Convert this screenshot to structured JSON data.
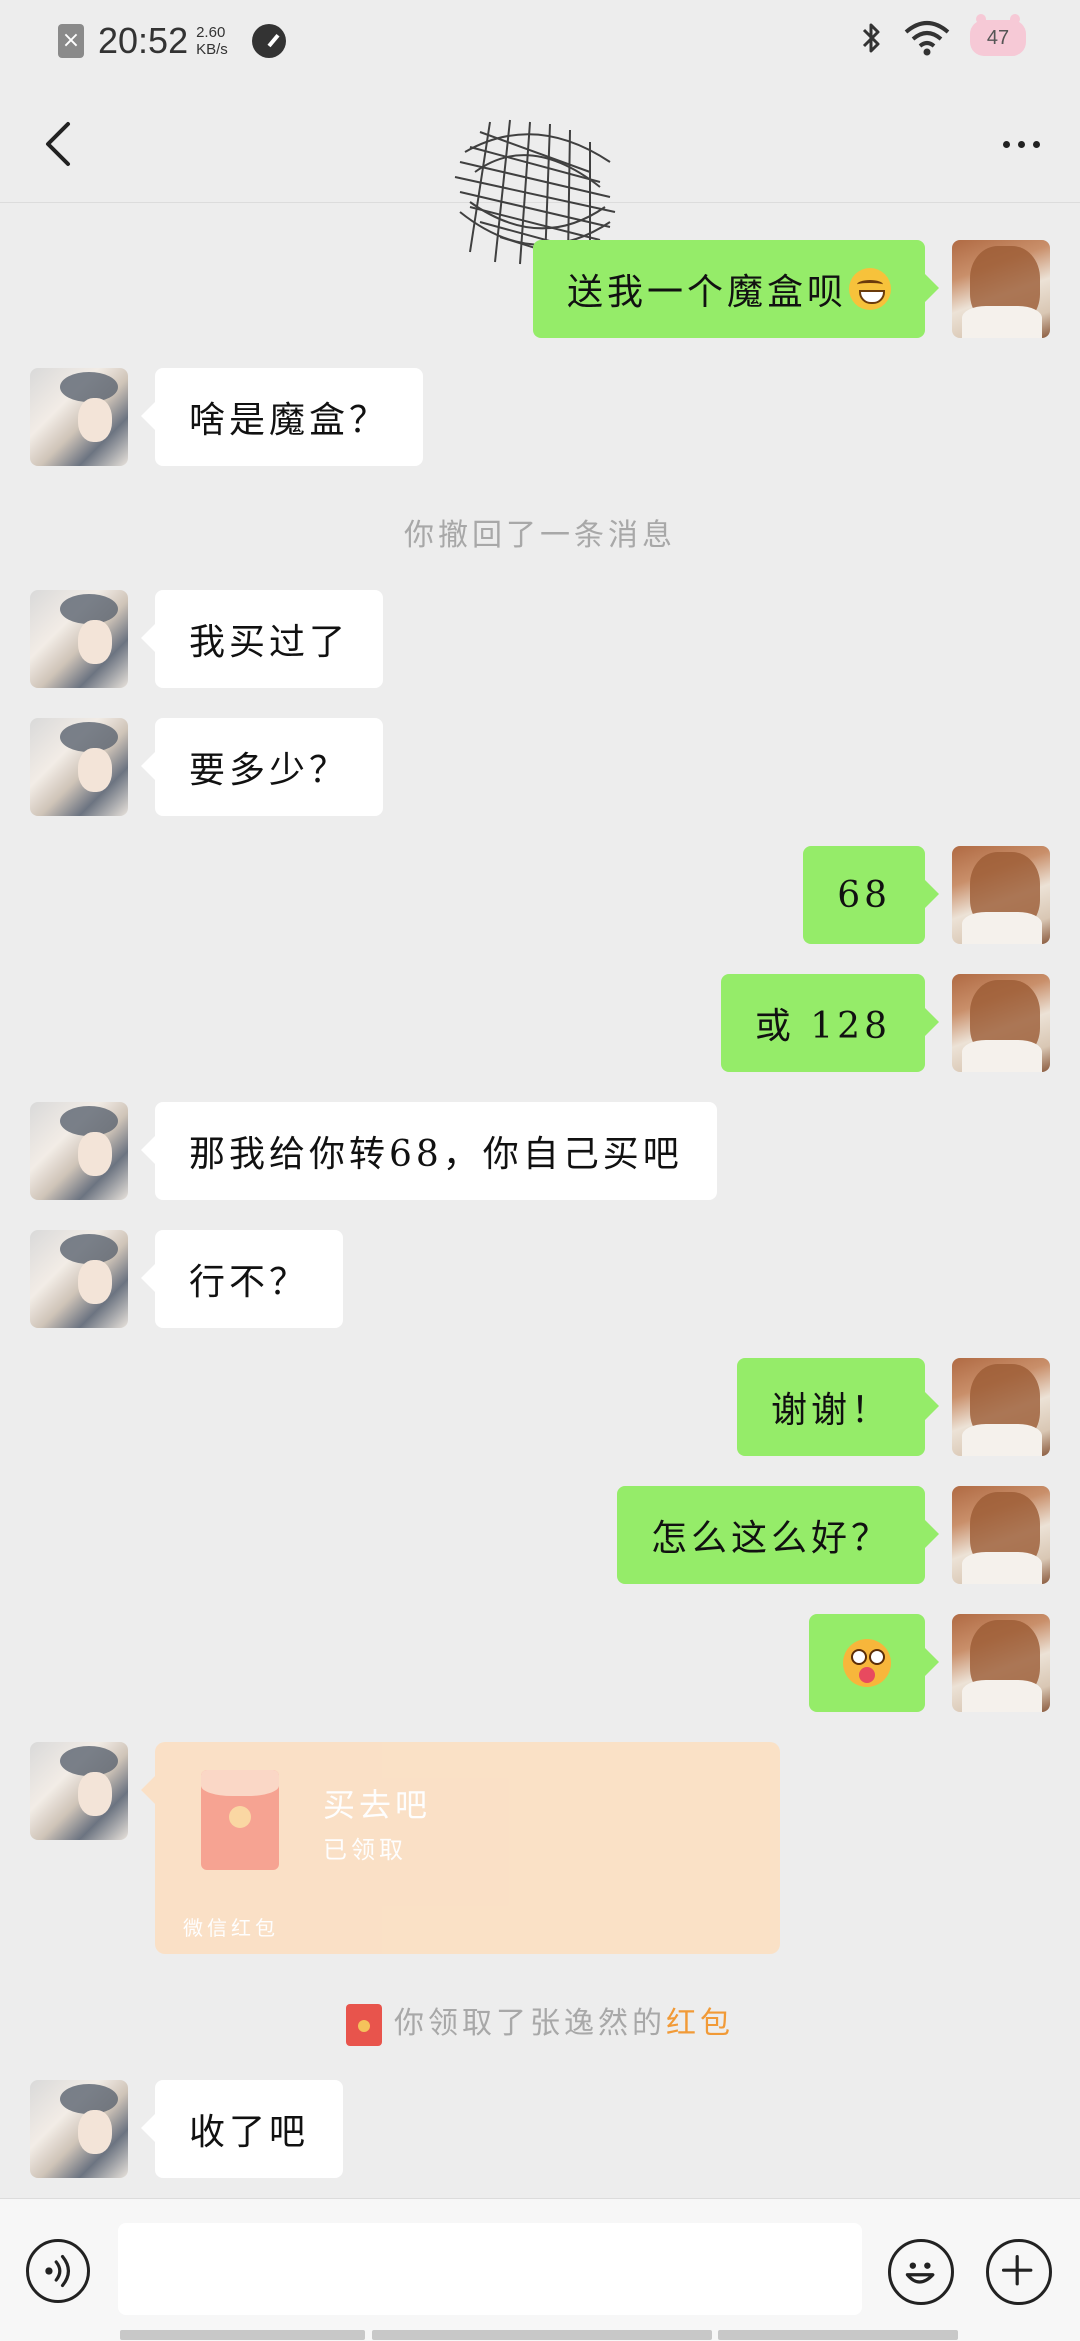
{
  "status_bar": {
    "time": "20:52",
    "net_speed_value": "2.60",
    "net_speed_unit": "KB/s",
    "battery_level": "47"
  },
  "messages": {
    "m1": "送我一个魔盒呗",
    "m2": "啥是魔盒？",
    "recall_notice": "你撤回了一条消息",
    "m3": "我买过了",
    "m4": "要多少？",
    "m5": "68",
    "m6": "或 128",
    "m7": "那我给你转68，你自己买吧",
    "m8": "行不？",
    "m9": "谢谢！",
    "m10": "怎么这么好？",
    "m12": "收了吧"
  },
  "red_packet": {
    "title": "买去吧",
    "status": "已领取",
    "footer": "微信红包"
  },
  "receipt_notice": {
    "prefix": "你领取了张逸然的",
    "highlight": "红包"
  },
  "colors": {
    "outgoing_bubble": "#95ec69",
    "incoming_bubble": "#ffffff",
    "background": "#ededed",
    "accent_orange": "#f19a37"
  },
  "icons": {
    "back": "chevron-left-icon",
    "more": "more-icon",
    "voice": "voice-icon",
    "emoji": "emoji-icon",
    "add": "plus-icon"
  }
}
